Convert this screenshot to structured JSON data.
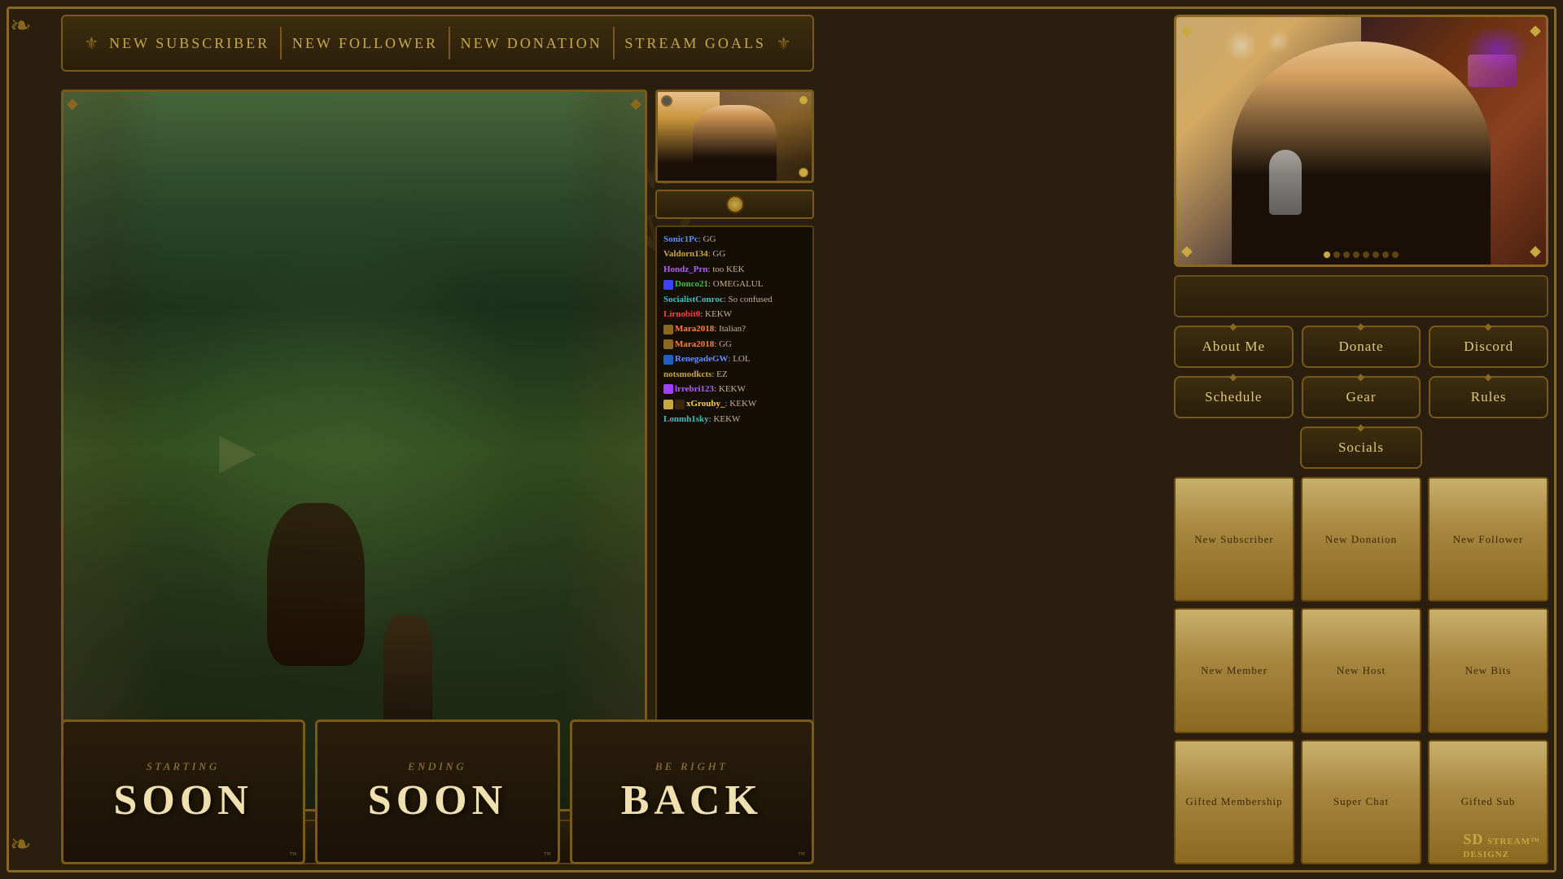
{
  "brand": {
    "name": "STREAM",
    "name2": "DESIGNZ",
    "logo": "SD STREAM™\nDESIGNZ"
  },
  "alert_bar": {
    "items": [
      "New Subscriber",
      "New Follower",
      "New Donation",
      "Stream Goals"
    ]
  },
  "nav_buttons": {
    "row1": [
      {
        "label": "About Me",
        "key": "about-me"
      },
      {
        "label": "Donate",
        "key": "donate"
      },
      {
        "label": "Discord",
        "key": "discord"
      }
    ],
    "row2": [
      {
        "label": "Schedule",
        "key": "schedule"
      },
      {
        "label": "Gear",
        "key": "gear"
      },
      {
        "label": "Rules",
        "key": "rules"
      }
    ],
    "row3": [
      {
        "label": "Socials",
        "key": "socials"
      }
    ]
  },
  "alert_panels": {
    "row1": [
      "New Subscriber",
      "New Donation",
      "New Follower"
    ],
    "row2": [
      "New Member",
      "New Host",
      "New Bits"
    ],
    "row3": [
      "Gifted Membership",
      "Super Chat",
      "Gifted Sub"
    ]
  },
  "scenes": {
    "starting": {
      "label": "STARTING",
      "main": "SOON"
    },
    "ending": {
      "label": "ENDING",
      "main": "SOON"
    },
    "brb": {
      "label": "BE RIGHT",
      "main": "BACK"
    }
  },
  "chat": {
    "messages": [
      {
        "user": "Sonic1Pc",
        "color": "blue",
        "text": "GG"
      },
      {
        "user": "Valdorn134",
        "color": "gold",
        "text": "GG"
      },
      {
        "user": "Hondz_Prn",
        "color": "purple",
        "text": "too KEK"
      },
      {
        "user": "Donco21",
        "color": "green",
        "text": "OMEGALUL",
        "badge": true
      },
      {
        "user": "SocialistConroc",
        "color": "teal",
        "text": "So confused"
      },
      {
        "user": "Lirnobit0",
        "color": "red",
        "text": "KEKW"
      },
      {
        "user": "Mara2018",
        "color": "orange",
        "text": "Italian?",
        "badge2": true
      },
      {
        "user": "Mara2018",
        "color": "orange",
        "text": "GG",
        "badge2": true
      },
      {
        "user": "RenegadeGW",
        "color": "blue",
        "text": "LOL",
        "badge3": true
      },
      {
        "user": "notsmodkcts",
        "color": "gold",
        "text": "EZ"
      },
      {
        "user": "lrrebri123",
        "color": "purple",
        "text": "KEKW",
        "badge4": true
      },
      {
        "user": "xGrouby_",
        "color": "yellow",
        "text": "KEKW",
        "badge5": true
      },
      {
        "user": "Lonmh1sky",
        "color": "teal",
        "text": "KEKW"
      }
    ]
  }
}
